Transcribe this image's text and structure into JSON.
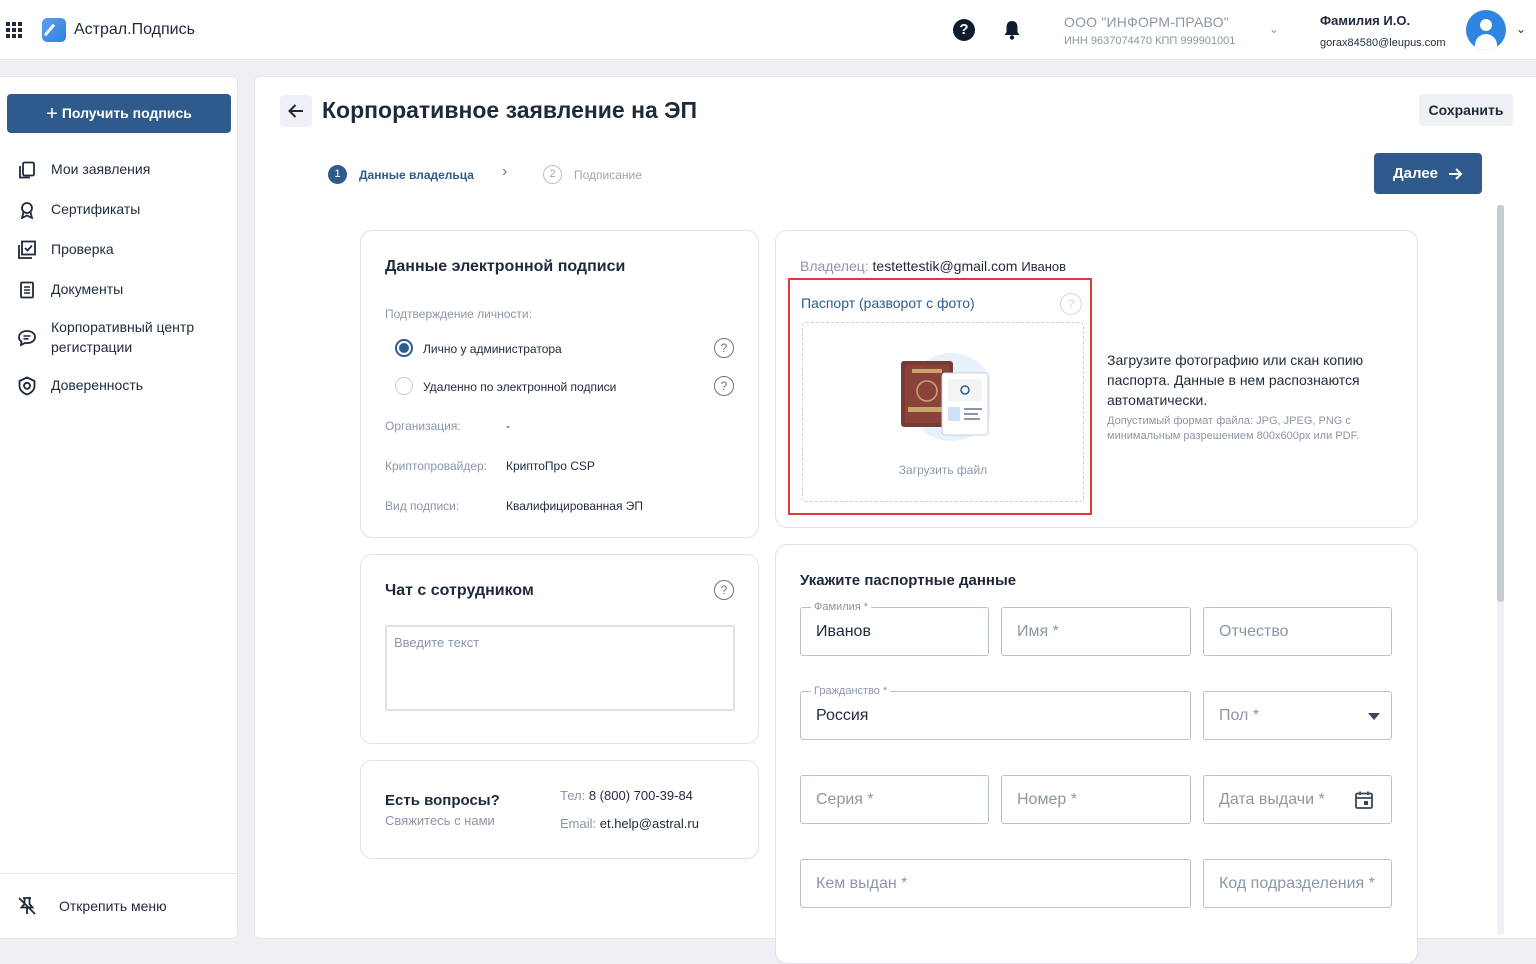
{
  "header": {
    "app_name": "Астрал.Подпись",
    "org_name": "ООО \"ИНФОРМ-ПРАВО\"",
    "org_details": "ИНН 9637074470   КПП 999901001",
    "user_name": "Фамилия И.О.",
    "user_email": "gorax84580@leupus.com"
  },
  "sidebar": {
    "get_signature_label": "Получить подпись",
    "items": [
      {
        "label": "Мои заявления",
        "icon": "applications-icon"
      },
      {
        "label": "Сертификаты",
        "icon": "certificate-icon"
      },
      {
        "label": "Проверка",
        "icon": "check-icon"
      },
      {
        "label": "Документы",
        "icon": "documents-icon"
      },
      {
        "label": "Корпоративный центр регистрации",
        "icon": "chat-bubble-icon"
      },
      {
        "label": "Доверенность",
        "icon": "shield-icon"
      }
    ],
    "unpin_label": "Открепить меню"
  },
  "page": {
    "title": "Корпоративное заявление на ЭП",
    "save_label": "Сохранить",
    "next_label": "Далее",
    "steps": [
      {
        "num": "1",
        "label": "Данные владельца"
      },
      {
        "num": "2",
        "label": "Подписание"
      }
    ]
  },
  "signature_card": {
    "title": "Данные электронной подписи",
    "identity_label": "Подтверждение личности:",
    "option_personal": "Лично у администратора",
    "option_remote": "Удаленно по электронной подписи",
    "org_label": "Организация:",
    "org_value": "-",
    "crypto_label": "Криптопровайдер:",
    "crypto_value": "КриптоПро CSP",
    "type_label": "Вид подписи:",
    "type_value": "Квалифицированная ЭП"
  },
  "chat_card": {
    "title": "Чат с сотрудником",
    "placeholder": "Введите текст"
  },
  "contact_card": {
    "title": "Есть вопросы?",
    "subtitle": "Свяжитесь с нами",
    "phone_label": "Тел:",
    "phone_value": "8 (800) 700-39-84",
    "email_label": "Email:",
    "email_value": "et.help@astral.ru"
  },
  "passport_upload": {
    "owner_label": "Владелец:",
    "owner_email": "testettestik@gmail.com",
    "owner_name": "Иванов",
    "title": "Паспорт (разворот с фото)",
    "upload_label": "Загрузить файл",
    "description": "Загрузите фотографию или скан копию паспорта. Данные в нем распознаются автоматически.",
    "format_hint": "Допустимый формат файла: JPG, JPEG, PNG с минимальным разрешением 800x600px или PDF."
  },
  "passport_form": {
    "title": "Укажите паспортные данные",
    "surname_label": "Фамилия *",
    "surname_value": "Иванов",
    "name_placeholder": "Имя *",
    "patronymic_placeholder": "Отчество",
    "citizenship_label": "Гражданство *",
    "citizenship_value": "Россия",
    "gender_placeholder": "Пол *",
    "series_placeholder": "Серия *",
    "number_placeholder": "Номер *",
    "issue_date_placeholder": "Дата выдачи *",
    "issued_by_placeholder": "Кем выдан *",
    "division_code_placeholder": "Код подразделения *"
  },
  "colors": {
    "primary": "#2e5b8c",
    "highlight_frame": "#e53935"
  }
}
